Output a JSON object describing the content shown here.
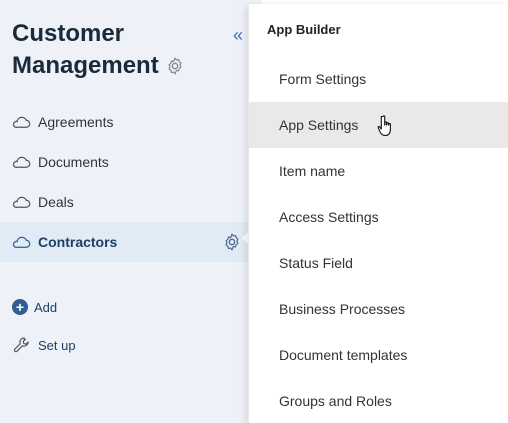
{
  "sidebar": {
    "title_line1": "Customer",
    "title_line2": "Management",
    "collapse_label": "«",
    "items": [
      {
        "label": "Agreements",
        "icon": "cloud-icon"
      },
      {
        "label": "Documents",
        "icon": "cloud-icon"
      },
      {
        "label": "Deals",
        "icon": "cloud-icon"
      },
      {
        "label": "Contractors",
        "icon": "cloud-icon",
        "active": true
      }
    ],
    "actions": {
      "add_label": "Add",
      "setup_label": "Set up"
    }
  },
  "menu": {
    "header": "App Builder",
    "items": [
      {
        "label": "Form Settings"
      },
      {
        "label": "App Settings",
        "hovered": true
      },
      {
        "label": "Item name"
      },
      {
        "label": "Access Settings"
      },
      {
        "label": "Status Field"
      },
      {
        "label": "Business Processes"
      },
      {
        "label": "Document templates"
      },
      {
        "label": "Groups and Roles"
      }
    ]
  },
  "colors": {
    "sidebar_bg": "#eef2f8",
    "active_bg": "#e1ebf5",
    "accent": "#3a73b6",
    "hover_bg": "#e9e9e9"
  }
}
